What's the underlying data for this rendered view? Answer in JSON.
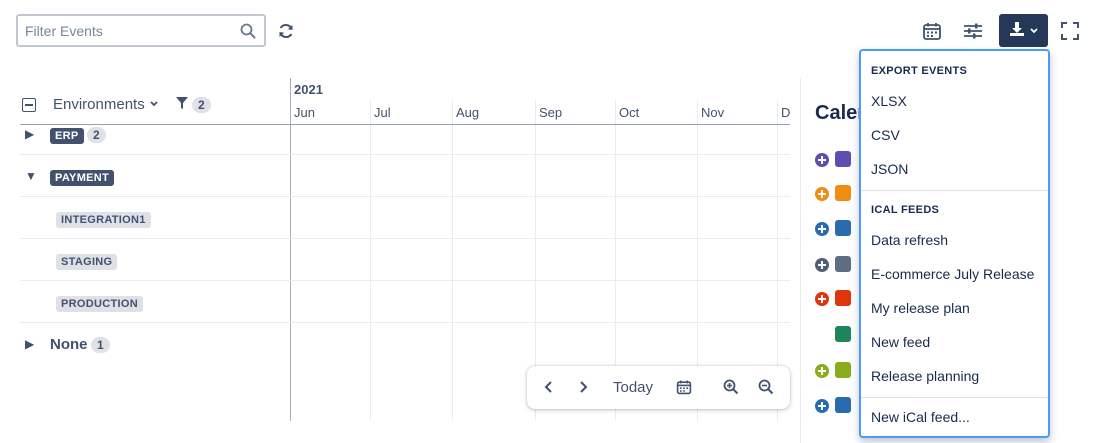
{
  "toolbar": {
    "filter_placeholder": "Filter Events",
    "icons": {
      "search": "search-icon",
      "refresh": "refresh-icon",
      "calendar": "calendar-icon",
      "settings": "sliders-icon",
      "export": "download-icon",
      "fullscreen": "fullscreen-icon"
    }
  },
  "tree": {
    "header_label": "Environments",
    "filter_count": "2",
    "rows": [
      {
        "label": "ERP",
        "count": "2",
        "expanded": false
      },
      {
        "label": "PAYMENT",
        "expanded": true
      },
      {
        "label": "INTEGRATION1"
      },
      {
        "label": "STAGING"
      },
      {
        "label": "PRODUCTION"
      },
      {
        "label": "None",
        "count": "1",
        "expanded": false
      }
    ]
  },
  "timeline": {
    "year": "2021",
    "months": [
      "Jun",
      "Jul",
      "Aug",
      "Sep",
      "Oct",
      "Nov",
      "D"
    ]
  },
  "navigation": {
    "today_label": "Today"
  },
  "calendars": {
    "title": "Calendars",
    "items": [
      {
        "color": "#5e4db2",
        "plus_color": "#5e4db2",
        "has_plus": true
      },
      {
        "color": "#f18d13",
        "plus_color": "#f18d13",
        "has_plus": true
      },
      {
        "color": "#2a6bb0",
        "plus_color": "#2a6bb0",
        "has_plus": true
      },
      {
        "color": "#5e6c84",
        "plus_color": "#505f79",
        "has_plus": true
      },
      {
        "color": "#de350b",
        "plus_color": "#de350b",
        "has_plus": true
      },
      {
        "color": "#1f845a",
        "plus_color": "#1f845a",
        "has_plus": false
      },
      {
        "color": "#8aad1d",
        "plus_color": "#8aad1d",
        "has_plus": true
      },
      {
        "color": "#2a6bb0",
        "plus_color": "#2a6bb0",
        "has_plus": true
      }
    ]
  },
  "export_menu": {
    "export_heading": "EXPORT EVENTS",
    "export_items": [
      "XLSX",
      "CSV",
      "JSON"
    ],
    "ical_heading": "ICAL FEEDS",
    "ical_items": [
      "Data refresh",
      "E-commerce July Release",
      "My release plan",
      "New feed",
      "Release planning"
    ],
    "new_feed_label": "New iCal feed...",
    "border_color": "#4c9aff"
  }
}
